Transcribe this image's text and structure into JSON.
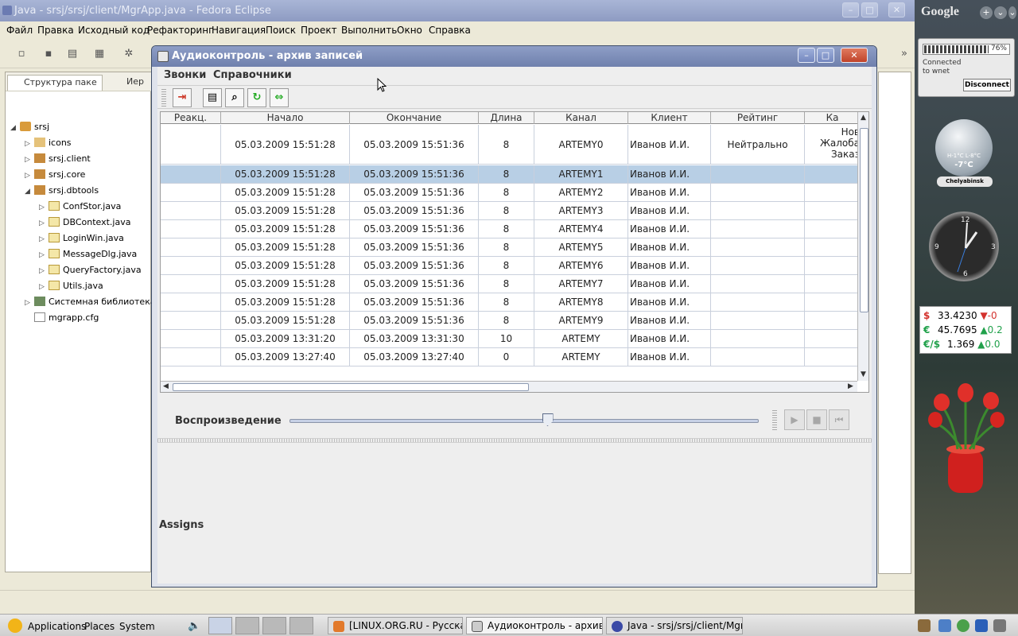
{
  "eclipse": {
    "title": "Java - srsj/srsj/client/MgrApp.java - Fedora Eclipse",
    "menu": [
      "Файл",
      "Правка",
      "Исходный код",
      "Рефакторинг",
      "Навигация",
      "Поиск",
      "Проект",
      "Выполнить",
      "Окно",
      "Справка"
    ],
    "panel_tab": "Структура паке",
    "panel_tab2": "Иер",
    "tree": [
      {
        "label": "srsj",
        "type": "proj",
        "depth": 0,
        "expanded": true
      },
      {
        "label": "icons",
        "type": "fold",
        "depth": 1,
        "expanded": false
      },
      {
        "label": "srsj.client",
        "type": "pkg",
        "depth": 1,
        "expanded": false
      },
      {
        "label": "srsj.core",
        "type": "pkg",
        "depth": 1,
        "expanded": false
      },
      {
        "label": "srsj.dbtools",
        "type": "pkg",
        "depth": 1,
        "expanded": true
      },
      {
        "label": "ConfStor.java",
        "type": "java",
        "depth": 2,
        "expanded": false
      },
      {
        "label": "DBContext.java",
        "type": "java",
        "depth": 2,
        "expanded": false
      },
      {
        "label": "LoginWin.java",
        "type": "java",
        "depth": 2,
        "expanded": false
      },
      {
        "label": "MessageDlg.java",
        "type": "java",
        "depth": 2,
        "expanded": false
      },
      {
        "label": "QueryFactory.java",
        "type": "java",
        "depth": 2,
        "expanded": false
      },
      {
        "label": "Utils.java",
        "type": "java",
        "depth": 2,
        "expanded": false
      },
      {
        "label": "Системная библиотека JI",
        "type": "lib",
        "depth": 1,
        "expanded": false
      },
      {
        "label": "mgrapp.cfg",
        "type": "file",
        "depth": 1,
        "expanded": null
      }
    ]
  },
  "dialog": {
    "title": "Аудиоконтроль - архив записей",
    "menu": [
      "Звонки",
      "Справочники"
    ],
    "columns": [
      "Реакц.",
      "Начало",
      "Окончание",
      "Длина",
      "Канал",
      "Клиент",
      "Рейтинг",
      "Ка"
    ],
    "first_row": {
      "start": "05.03.2009 15:51:28",
      "end": "05.03.2009 15:51:36",
      "len": "8",
      "channel": "ARTEMY0",
      "client": "Иванов И.И.",
      "rating": "Нейтрально",
      "cat": [
        "Нов",
        "Жалоба",
        "Заказ"
      ]
    },
    "rows": [
      {
        "start": "05.03.2009 15:51:28",
        "end": "05.03.2009 15:51:36",
        "len": "8",
        "channel": "ARTEMY1",
        "client": "Иванов И.И."
      },
      {
        "start": "05.03.2009 15:51:28",
        "end": "05.03.2009 15:51:36",
        "len": "8",
        "channel": "ARTEMY2",
        "client": "Иванов И.И."
      },
      {
        "start": "05.03.2009 15:51:28",
        "end": "05.03.2009 15:51:36",
        "len": "8",
        "channel": "ARTEMY3",
        "client": "Иванов И.И."
      },
      {
        "start": "05.03.2009 15:51:28",
        "end": "05.03.2009 15:51:36",
        "len": "8",
        "channel": "ARTEMY4",
        "client": "Иванов И.И."
      },
      {
        "start": "05.03.2009 15:51:28",
        "end": "05.03.2009 15:51:36",
        "len": "8",
        "channel": "ARTEMY5",
        "client": "Иванов И.И."
      },
      {
        "start": "05.03.2009 15:51:28",
        "end": "05.03.2009 15:51:36",
        "len": "8",
        "channel": "ARTEMY6",
        "client": "Иванов И.И."
      },
      {
        "start": "05.03.2009 15:51:28",
        "end": "05.03.2009 15:51:36",
        "len": "8",
        "channel": "ARTEMY7",
        "client": "Иванов И.И."
      },
      {
        "start": "05.03.2009 15:51:28",
        "end": "05.03.2009 15:51:36",
        "len": "8",
        "channel": "ARTEMY8",
        "client": "Иванов И.И."
      },
      {
        "start": "05.03.2009 15:51:28",
        "end": "05.03.2009 15:51:36",
        "len": "8",
        "channel": "ARTEMY9",
        "client": "Иванов И.И."
      },
      {
        "start": "05.03.2009 13:31:20",
        "end": "05.03.2009 13:31:30",
        "len": "10",
        "channel": "ARTEMY",
        "client": "Иванов И.И."
      },
      {
        "start": "05.03.2009 13:27:40",
        "end": "05.03.2009 13:27:40",
        "len": "0",
        "channel": "ARTEMY",
        "client": "Иванов И.И."
      }
    ],
    "playback_label": "Воспроизведение",
    "playback_position": 0.55,
    "assigns_label": "Assigns"
  },
  "side": {
    "google": "Google",
    "net_percent": "76%",
    "net_fill": 0.76,
    "net_status": "Connected to wnet",
    "disconnect": "Disconnect",
    "weather_range": "H-1°C L-8°C",
    "weather_temp": "-7°C",
    "city": "Chelyabinsk",
    "stocks": [
      {
        "sym": "$",
        "value": "33.4230",
        "dir": "dn",
        "chg": "-0"
      },
      {
        "sym": "€",
        "value": "45.7695",
        "dir": "up",
        "chg": "0.2"
      },
      {
        "sym": "€/$",
        "value": "1.369",
        "dir": "up",
        "chg": "0.0"
      }
    ]
  },
  "taskbar": {
    "menus": [
      "Applications",
      "Places",
      "System"
    ],
    "tasks": [
      "[LINUX.ORG.RU - Русска...",
      "Аудиоконтроль - архив ...",
      "Java - srsj/srsj/client/Mgr..."
    ]
  },
  "colors": {
    "selection": "#b8cfe5",
    "title_dialog": "#7d8ebb",
    "close": "#c94a30"
  }
}
